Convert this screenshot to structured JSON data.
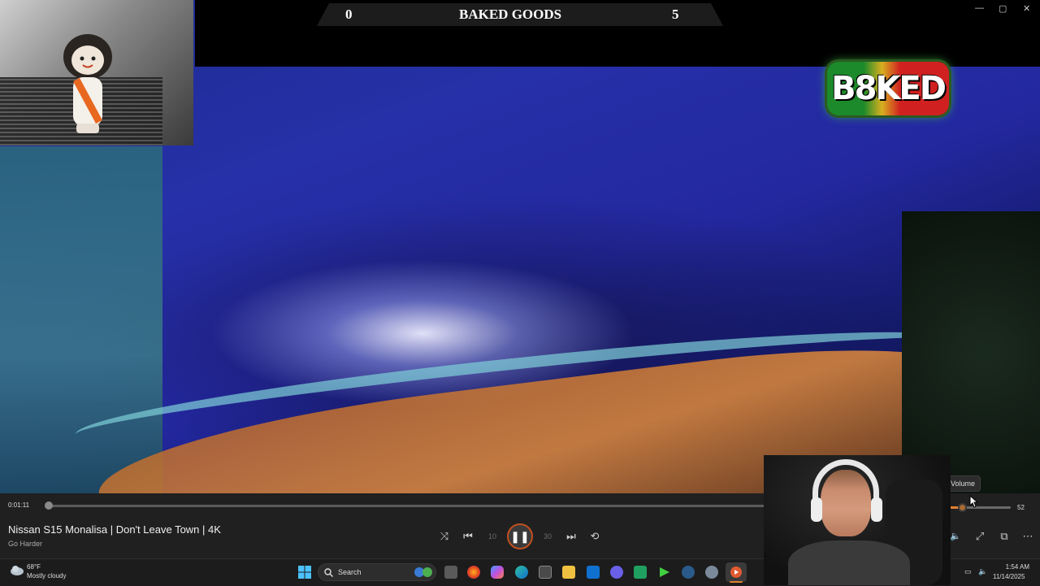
{
  "scoreboard": {
    "left_score": "0",
    "title": "BAKED GOODS",
    "right_score": "5"
  },
  "logo_text": "B8KED",
  "window_controls": {
    "minimize": "—",
    "maximize": "▢",
    "close": "✕"
  },
  "player": {
    "current_time": "0:01:11",
    "title": "Nissan S15 Monalisa | Don't Leave Town | 4K",
    "artist": "Go Harder",
    "progress_fraction": 0.004,
    "volume": "52",
    "volume_fraction": 0.52,
    "tooltip": "Volume",
    "accent_color": "#e08030",
    "controls": {
      "shuffle": "⤨",
      "previous": "⏮",
      "rewind": "10",
      "play_pause": "❚❚",
      "forward": "30",
      "next": "⏭",
      "repeat": "⟲",
      "volume_icon": "🔈",
      "fullscreen": "⤢",
      "miniplayer": "⧉",
      "more": "⋯"
    }
  },
  "taskbar": {
    "weather_temp": "68°F",
    "weather_desc": "Mostly cloudy",
    "search_placeholder": "Search",
    "time": "1:54 AM",
    "date": "11/14/2025",
    "apps": [
      "start",
      "search",
      "copilot",
      "task-view",
      "firefox",
      "copilot-app",
      "edge",
      "store",
      "file-explorer",
      "outlook",
      "discord",
      "app-green",
      "terminal",
      "steam",
      "settings",
      "media-player"
    ]
  }
}
